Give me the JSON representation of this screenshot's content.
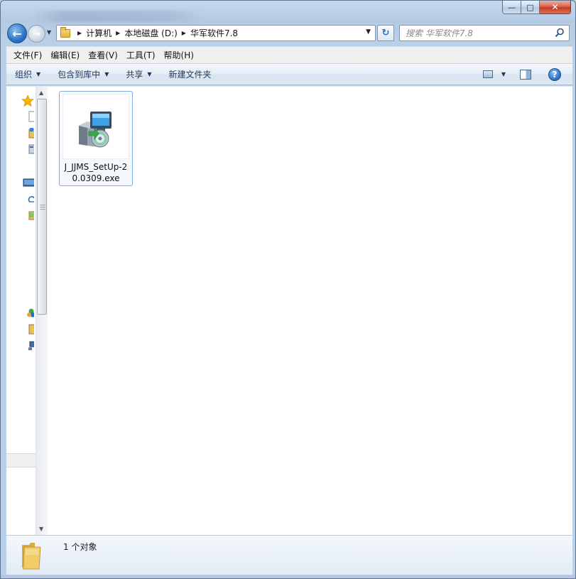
{
  "window": {
    "caption_buttons": {
      "minimize": "—",
      "maximize": "□",
      "close": "✕"
    }
  },
  "nav": {
    "breadcrumbs": [
      "计算机",
      "本地磁盘 (D:)",
      "华军软件7.8"
    ],
    "search_placeholder": "搜索 华军软件7.8"
  },
  "menubar": {
    "items": [
      "文件(F)",
      "编辑(E)",
      "查看(V)",
      "工具(T)",
      "帮助(H)"
    ]
  },
  "commandbar": {
    "organize": "组织",
    "include_in_library": "包含到库中",
    "share": "共享",
    "new_folder": "新建文件夹"
  },
  "files": [
    {
      "name": "J_JJMS_SetUp-20.0309.exe",
      "icon": "installer-icon"
    }
  ],
  "details": {
    "count_text": "1 个对象"
  },
  "colors": {
    "accent_blue": "#2c6fc0",
    "selection_border": "#84acdd",
    "folder_yellow": "#e8c15a"
  }
}
